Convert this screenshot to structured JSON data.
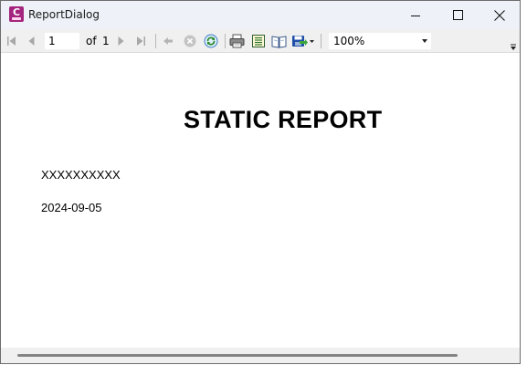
{
  "window": {
    "title": "ReportDialog",
    "app_icon_letter": "C",
    "app_icon_color": "#a4257d"
  },
  "toolbar": {
    "icons": [
      "first-page-icon",
      "previous-page-icon",
      "next-page-icon",
      "last-page-icon",
      "back-icon",
      "stop-icon",
      "refresh-icon",
      "print-icon",
      "print-layout-icon",
      "page-setup-icon",
      "export-icon"
    ],
    "current_page": "1",
    "of_label": "of",
    "total_pages": "1",
    "zoom_value": "100%",
    "refresh_color": "#2e8b2e",
    "export_color": "#1f4fa8"
  },
  "report": {
    "title": "STATIC REPORT",
    "field_1": "XXXXXXXXXX",
    "field_2": "2024-09-05"
  }
}
